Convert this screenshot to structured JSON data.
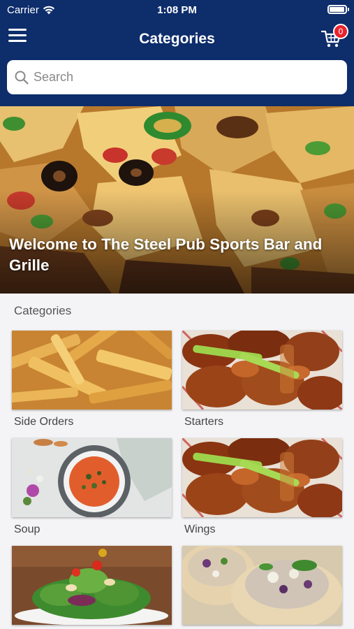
{
  "status_bar": {
    "carrier": "Carrier",
    "time": "1:08 PM",
    "battery_level": 0.95
  },
  "nav": {
    "title": "Categories",
    "cart_count": "0"
  },
  "search": {
    "placeholder": "Search"
  },
  "hero": {
    "title": "Welcome to The Steel Pub Sports Bar and Grille"
  },
  "section": {
    "label": "Categories"
  },
  "categories": [
    {
      "label": "Side Orders",
      "image": "fries"
    },
    {
      "label": "Starters",
      "image": "wings"
    },
    {
      "label": "Soup",
      "image": "soup"
    },
    {
      "label": "Wings",
      "image": "wings"
    },
    {
      "label": "",
      "image": "salad"
    },
    {
      "label": "",
      "image": "wraps"
    }
  ],
  "colors": {
    "header": "#0d2d6b",
    "badge": "#e8232f",
    "background": "#f4f4f6"
  }
}
